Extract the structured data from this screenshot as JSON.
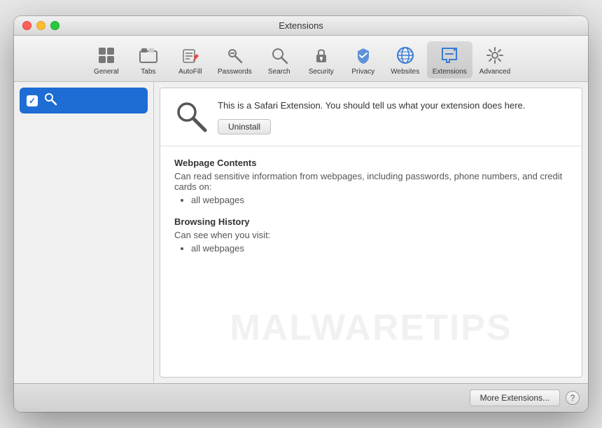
{
  "window": {
    "title": "Extensions"
  },
  "controls": {
    "close": "close",
    "minimize": "minimize",
    "maximize": "maximize"
  },
  "toolbar": {
    "items": [
      {
        "id": "general",
        "label": "General",
        "icon": "general"
      },
      {
        "id": "tabs",
        "label": "Tabs",
        "icon": "tabs"
      },
      {
        "id": "autofill",
        "label": "AutoFill",
        "icon": "autofill"
      },
      {
        "id": "passwords",
        "label": "Passwords",
        "icon": "passwords"
      },
      {
        "id": "search",
        "label": "Search",
        "icon": "search"
      },
      {
        "id": "security",
        "label": "Security",
        "icon": "security"
      },
      {
        "id": "privacy",
        "label": "Privacy",
        "icon": "privacy"
      },
      {
        "id": "websites",
        "label": "Websites",
        "icon": "websites"
      },
      {
        "id": "extensions",
        "label": "Extensions",
        "icon": "extensions",
        "active": true
      },
      {
        "id": "advanced",
        "label": "Advanced",
        "icon": "advanced"
      }
    ]
  },
  "sidebar": {
    "items": [
      {
        "id": "search-ext",
        "label": "",
        "checked": true,
        "selected": true
      }
    ]
  },
  "extension": {
    "description": "This is a Safari Extension. You should tell us what your extension does here.",
    "uninstall_label": "Uninstall",
    "sections": [
      {
        "title": "Webpage Contents",
        "description": "Can read sensitive information from webpages, including passwords, phone numbers, and credit cards on:",
        "items": [
          "all webpages"
        ]
      },
      {
        "title": "Browsing History",
        "description": "Can see when you visit:",
        "items": [
          "all webpages"
        ]
      }
    ]
  },
  "bottom_bar": {
    "more_extensions_label": "More Extensions...",
    "help_label": "?"
  },
  "watermark": {
    "text": "MALWARETIPS"
  }
}
